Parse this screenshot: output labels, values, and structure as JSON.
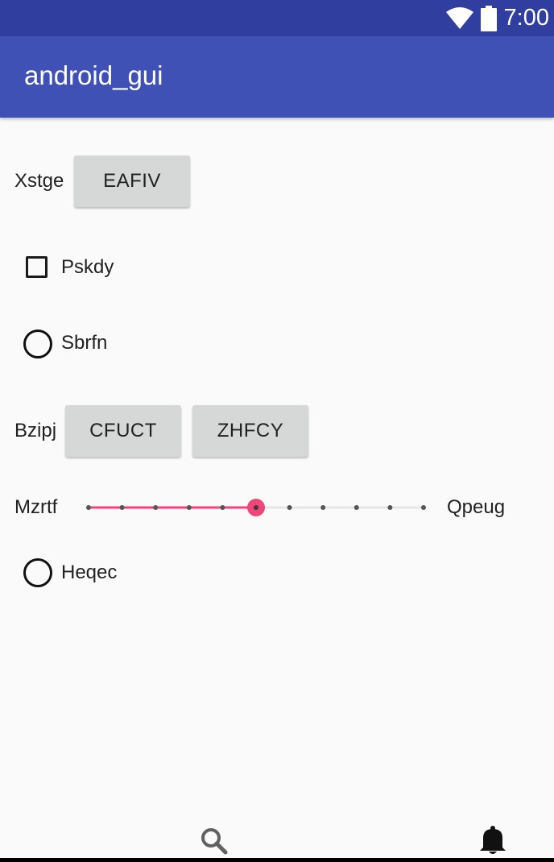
{
  "status_bar": {
    "time": "7:00",
    "icons": [
      "wifi-icon",
      "battery-icon"
    ],
    "background": "#303f9f"
  },
  "app_bar": {
    "title": "android_gui",
    "background": "#3f51b5"
  },
  "rows": {
    "row1": {
      "label": "Xstge",
      "button": "EAFIV"
    },
    "checkbox": {
      "label": "Pskdy",
      "checked": false
    },
    "radio1": {
      "label": "Sbrfn",
      "selected": false
    },
    "row2": {
      "label": "Bzipj",
      "buttons": [
        "CFUCT",
        "ZHFCY"
      ]
    },
    "slider": {
      "left_label": "Mzrtf",
      "right_label": "Qpeug",
      "min": 0,
      "max": 10,
      "value": 5,
      "accent": "#f0457a"
    },
    "radio2": {
      "label": "Heqec",
      "selected": false
    }
  },
  "bottom_nav": {
    "icons": [
      "search-icon",
      "bell-icon"
    ]
  }
}
